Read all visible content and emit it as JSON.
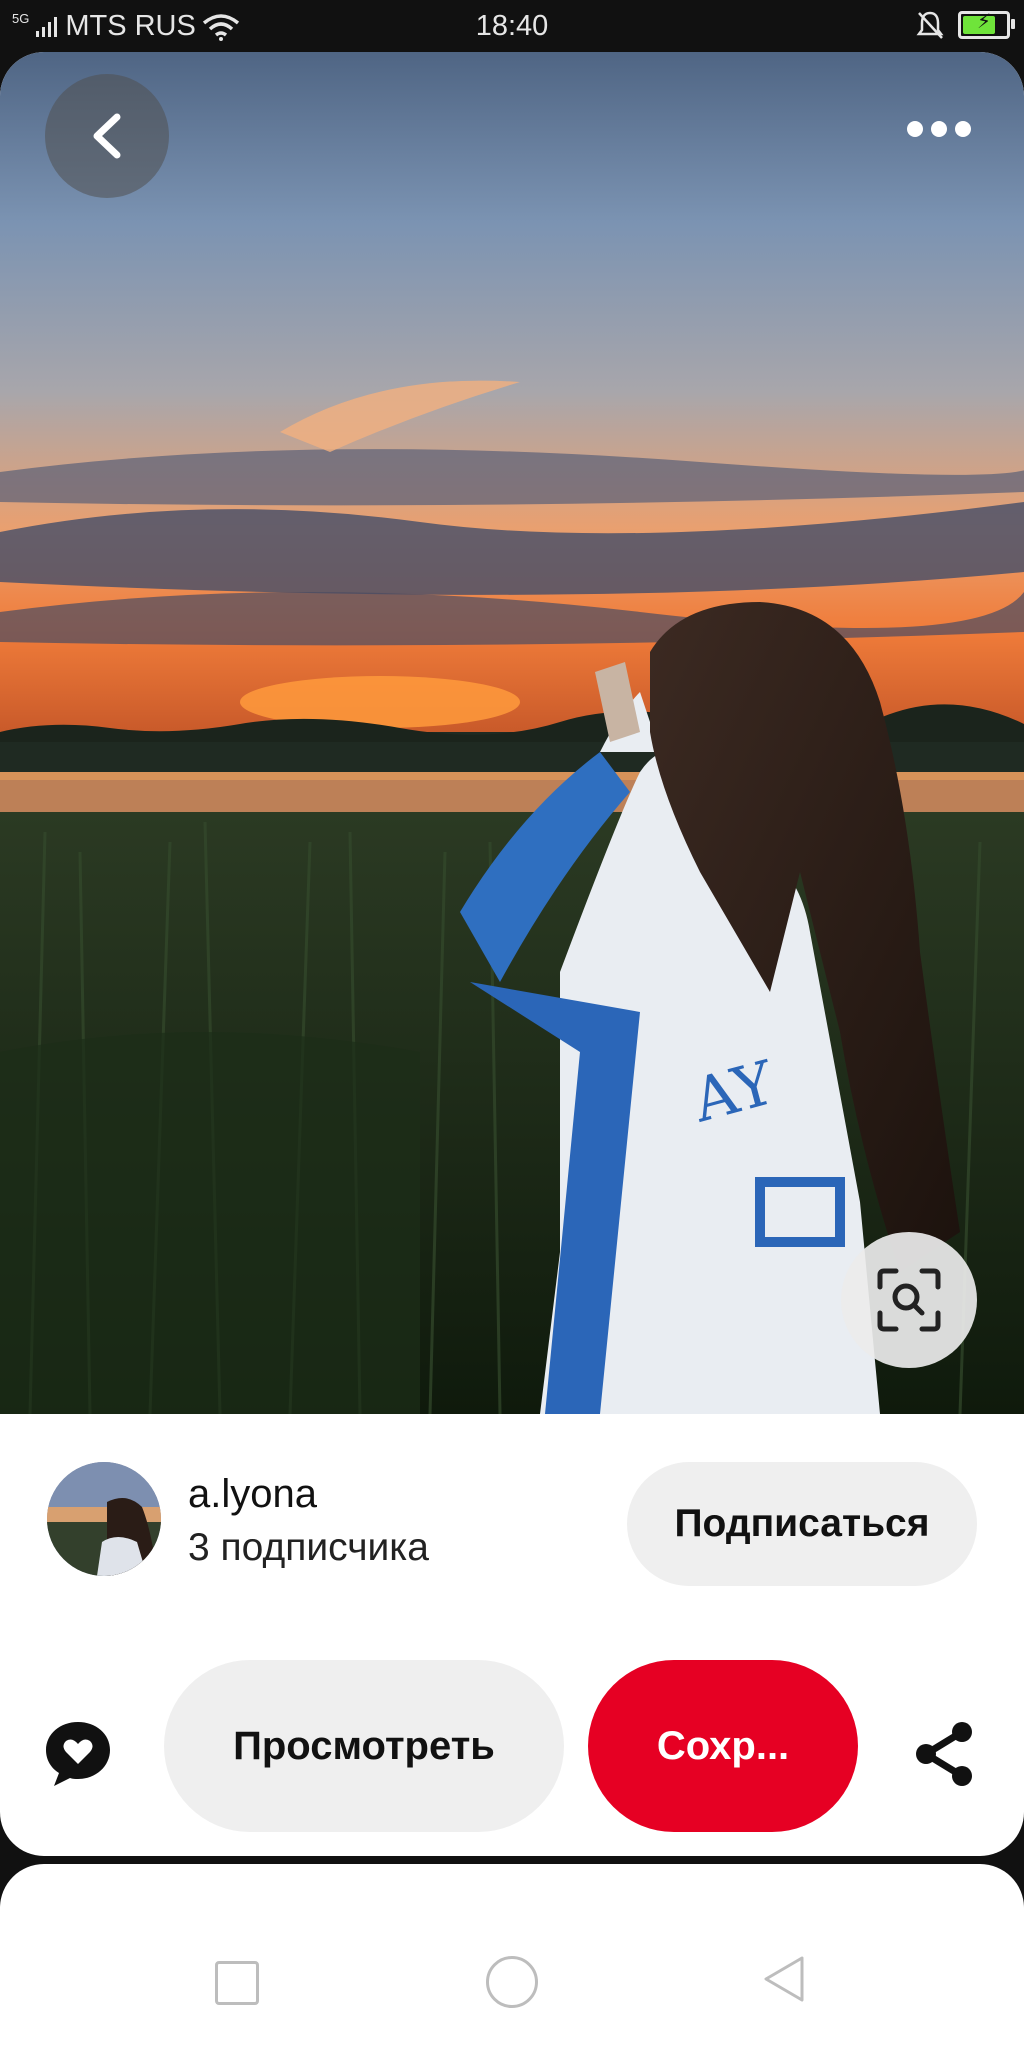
{
  "status_bar": {
    "network": "5G",
    "carrier": "MTS RUS",
    "time": "18:40",
    "battery_level": 0.7
  },
  "pin": {
    "author_name": "a.lyona",
    "author_subscribers": "3 подписчика",
    "follow_label": "Подписаться",
    "view_label": "Просмотреть",
    "save_label": "Сохр..."
  },
  "colors": {
    "save_button": "#e60023",
    "secondary_button": "#efefef"
  },
  "icons": {
    "back": "chevron-left-icon",
    "more": "more-dots-icon",
    "visual_search": "lens-search-icon",
    "comment": "comment-heart-icon",
    "share": "share-icon"
  }
}
